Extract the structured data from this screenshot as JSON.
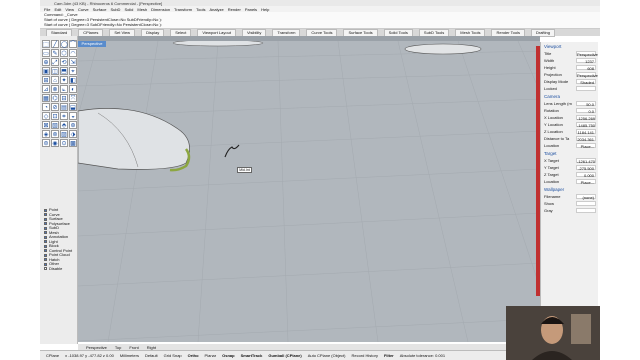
{
  "window": {
    "title": "Cam.3dm (43 KB) - Rhinoceros 6 Commercial - [Perspective]"
  },
  "menu": [
    "File",
    "Edit",
    "View",
    "Curve",
    "Surface",
    "SubD",
    "Solid",
    "Mesh",
    "Dimension",
    "Transform",
    "Tools",
    "Analyze",
    "Render",
    "Panels",
    "Help"
  ],
  "command": {
    "line1": "Command: _Curve",
    "line2": "Start of curve ( Degree=3  PersistentClose=No  SubDFriendly=No ):",
    "line3": "Start of curve ( Degree=3  SubDFriendly=No  PersistentClose=No ):"
  },
  "tabs": [
    "Standard",
    "CPlanes",
    "Set View",
    "Display",
    "Select",
    "Viewport Layout",
    "Visibility",
    "Transform",
    "Curve Tools",
    "Surface Tools",
    "Solid Tools",
    "SubD Tools",
    "Mesh Tools",
    "Render Tools",
    "Drafting"
  ],
  "viewport": {
    "label": "Perspective",
    "tooltip": "Mid.Int"
  },
  "osnap": {
    "items": [
      {
        "label": "Point",
        "on": true
      },
      {
        "label": "Curve",
        "on": true
      },
      {
        "label": "Surface",
        "on": true
      },
      {
        "label": "Polysurface",
        "on": true
      },
      {
        "label": "SubD",
        "on": true
      },
      {
        "label": "Mesh",
        "on": true
      },
      {
        "label": "Annotation",
        "on": true
      },
      {
        "label": "Light",
        "on": true
      },
      {
        "label": "Block",
        "on": true
      },
      {
        "label": "Control Point",
        "on": true
      },
      {
        "label": "Point Cloud",
        "on": true
      },
      {
        "label": "Hatch",
        "on": true
      },
      {
        "label": "Other",
        "on": true
      },
      {
        "label": "Disable",
        "on": false
      }
    ]
  },
  "properties": {
    "viewport_title": "Viewport",
    "viewport_rows": [
      {
        "k": "Title",
        "v": "Perspective"
      },
      {
        "k": "Width",
        "v": "1237"
      },
      {
        "k": "Height",
        "v": "608"
      },
      {
        "k": "Projection",
        "v": "Perspective"
      },
      {
        "k": "Display Mode",
        "v": "Shaded"
      },
      {
        "k": "Locked",
        "v": ""
      }
    ],
    "camera_title": "Camera",
    "camera_rows": [
      {
        "k": "Lens Length (m",
        "v": "50.0"
      },
      {
        "k": "Rotation",
        "v": "0.0"
      },
      {
        "k": "X Location",
        "v": "-1256.269"
      },
      {
        "k": "Y Location",
        "v": "-1485.750"
      },
      {
        "k": "Z Location",
        "v": "1184.141"
      },
      {
        "k": "Distance to Ta",
        "v": "2034.361"
      },
      {
        "k": "Location",
        "v": "Place..."
      }
    ],
    "target_title": "Target",
    "target_rows": [
      {
        "k": "X Target",
        "v": "-1261.470"
      },
      {
        "k": "Y Target",
        "v": "-275.500"
      },
      {
        "k": "Z Target",
        "v": "0.000"
      },
      {
        "k": "Location",
        "v": "Place..."
      }
    ],
    "wallpaper_title": "Wallpaper",
    "wallpaper_rows": [
      {
        "k": "Filename",
        "v": "(none)"
      },
      {
        "k": "Show",
        "v": ""
      },
      {
        "k": "Gray",
        "v": ""
      }
    ]
  },
  "viewport_tabs": [
    "Perspective",
    "Top",
    "Front",
    "Right"
  ],
  "status": {
    "cplane": "CPlane",
    "coords": "x -1038.97  y -477.82  z 0.00",
    "units": "Millimeters",
    "layer": "Default",
    "toggles": [
      {
        "label": "Grid Snap",
        "on": false
      },
      {
        "label": "Ortho",
        "on": true
      },
      {
        "label": "Planar",
        "on": false
      },
      {
        "label": "Osnap",
        "on": true
      },
      {
        "label": "SmartTrack",
        "on": true
      },
      {
        "label": "Gumball (CPlane)",
        "on": true
      },
      {
        "label": "Auto CPlane (Object)",
        "on": false
      },
      {
        "label": "Record History",
        "on": false
      },
      {
        "label": "Filter",
        "on": true
      }
    ],
    "tolerance": "Absolute tolerance: 0.001"
  },
  "colors": {
    "viewport_bg": "#b1b7bd",
    "accent": "#5a8ccc",
    "highlight": "#8ca640"
  }
}
